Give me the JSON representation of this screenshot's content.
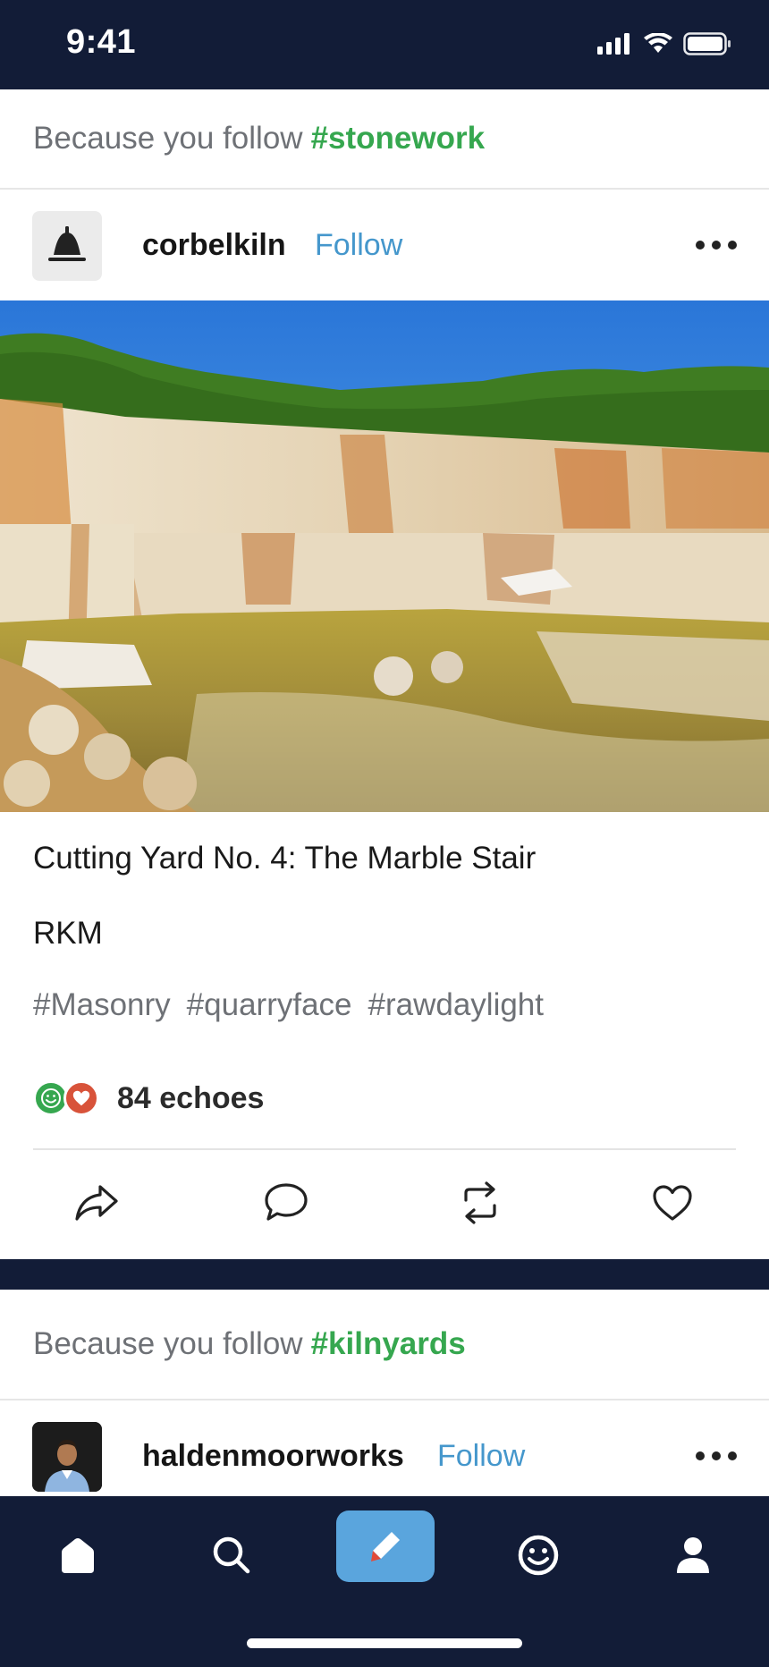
{
  "status_bar": {
    "time": "9:41"
  },
  "feed": [
    {
      "reason_prefix": "Because you follow",
      "reason_tag": "#stonework",
      "username": "corbelkiln",
      "follow_label": "Follow",
      "image_icon": "marble-quarry-photo",
      "title": "Cutting Yard No. 4: The Marble Stair",
      "author": "RKM",
      "tags": [
        "#Masonry",
        "#quarryface",
        "#rawdaylight"
      ],
      "echoes": "84 echoes"
    },
    {
      "reason_prefix": "Because you follow",
      "reason_tag": "#kilnyards",
      "username": "haldenmoorworks",
      "follow_label": "Follow"
    }
  ],
  "actions": [
    "share-icon",
    "comment-icon",
    "reblog-icon",
    "like-icon"
  ],
  "tab_bar": [
    "home-icon",
    "search-icon",
    "compose-icon",
    "activity-icon",
    "profile-icon"
  ],
  "colors": {
    "navy": "#121c37",
    "tag_green": "#36a74f",
    "follow_blue": "#4597cc",
    "compose_blue": "#5aa5dd",
    "heart_red": "#d8533a"
  }
}
